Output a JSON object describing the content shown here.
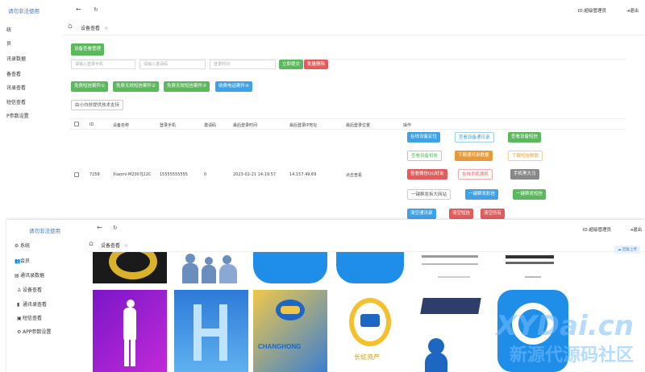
{
  "top": {
    "brand": "请勿非法使用",
    "sidebar": [
      "统",
      "员",
      "讯录数据",
      "备查看",
      "讯录查看",
      "短信查看",
      "P参数设置"
    ],
    "user": "ID:超级管理员",
    "logout": "退出",
    "tab": "设备查看",
    "manage_btn": "设备查看管理",
    "search": {
      "phone_placeholder": "请输入登录手机",
      "invite_placeholder": "请输入邀请码",
      "time_placeholder": "登录时间",
      "submit": "立即提交",
      "batch_delete": "批量删除"
    },
    "free_btns": [
      "免费短信案件①",
      "免费无效短信案件②",
      "免费无效短信案件③"
    ],
    "call_btn": "收费电话案件④",
    "support_btn": "由小白技提供技术支持",
    "table": {
      "headers": [
        "ID",
        "设备名称",
        "登录手机",
        "邀请码",
        "最后登录时间",
        "最后登录IP地址",
        "最后登录位置",
        "操作"
      ],
      "row": {
        "id": "7258",
        "device": "Xiaomi-M2007J22C",
        "phone": "15555555555",
        "invite": "0",
        "time": "2023-02-21 14:19:57",
        "ip": "14.157.49.69",
        "location": "点击查看"
      },
      "ops": [
        [
          "在线设备定位",
          "查看设备通讯录",
          "查看设备短信"
        ],
        [
          "查看设备相册",
          "下载通讯录数据",
          "下载短信数据"
        ],
        [
          "查看微信QQ好友",
          "在线手机拨机",
          "手机黑大马"
        ],
        [
          "一键群发拆大网站",
          "一键群发彩信",
          "一键群发短信"
        ],
        [
          "清空通讯录",
          "清空短信",
          "清空所有"
        ]
      ]
    }
  },
  "bottom": {
    "brand": "请勿非法使用",
    "sidebar": [
      "系统",
      "会员",
      "通讯录数据",
      "设备查看",
      "通讯录查看",
      "短信查看",
      "APP参数设置"
    ],
    "user": "ID:超级管理员",
    "logout": "退出",
    "tab": "设备查看",
    "badge": "回复上传",
    "image_text": "CHANGHONG",
    "image_text2": "长虹资产",
    "watermark1": "XYDai.cn",
    "watermark2": "新源代源码社区"
  }
}
